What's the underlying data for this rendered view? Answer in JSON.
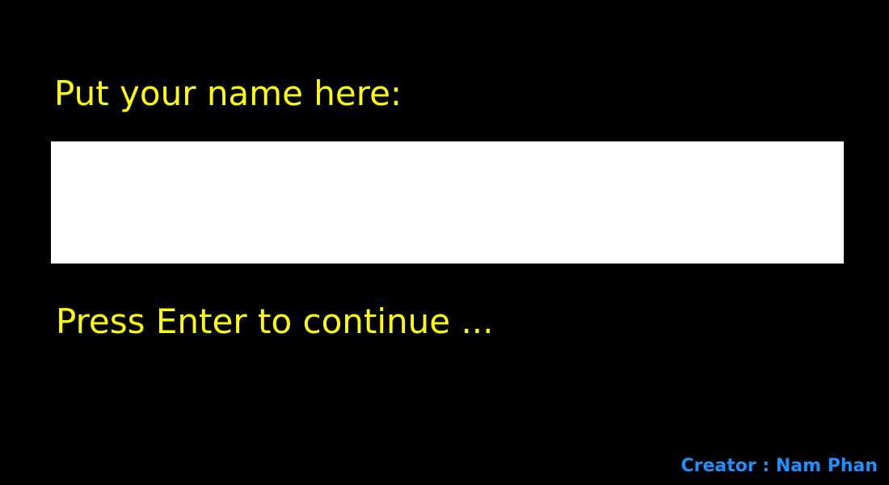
{
  "screen": {
    "prompt_label": "Put your name here:",
    "name_input": {
      "value": "",
      "placeholder": ""
    },
    "continue_hint": "Press Enter to continue ...",
    "credit": "Creator : Nam Phan"
  },
  "colors": {
    "background": "#000000",
    "prompt_text": "#ffff00",
    "input_background": "#ffffff",
    "credit_text": "#1e90ff"
  }
}
